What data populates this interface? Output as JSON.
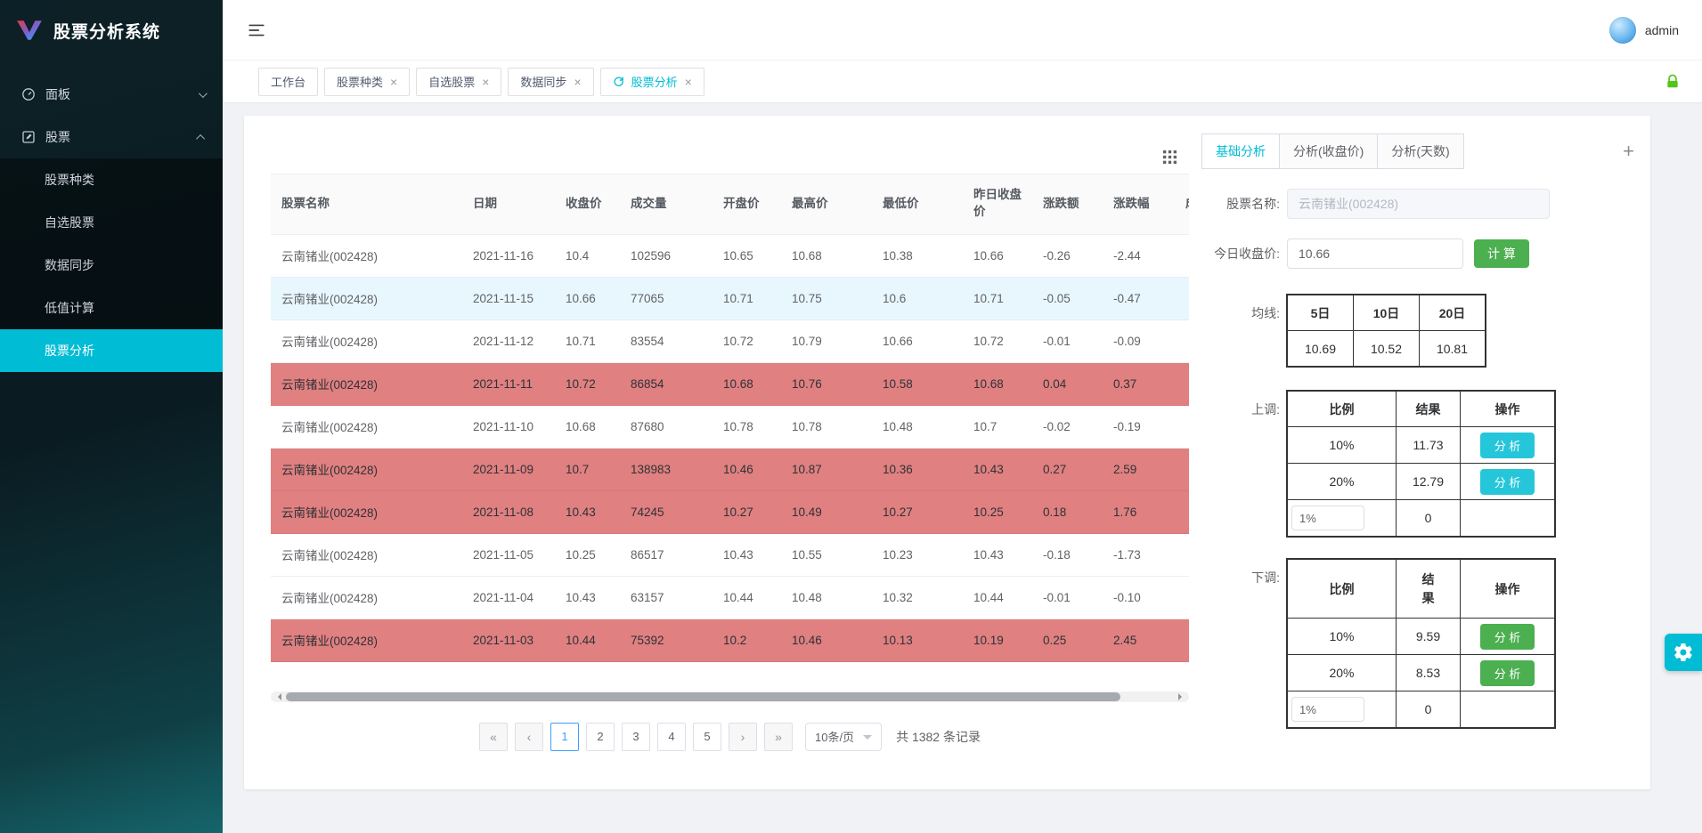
{
  "app": {
    "title": "股票分析系统"
  },
  "topbar": {
    "username": "admin"
  },
  "sidebar": {
    "items": [
      {
        "label": "面板",
        "icon": "dashboard-icon",
        "state": "collapsed"
      },
      {
        "label": "股票",
        "icon": "edit-square-icon",
        "state": "expanded"
      }
    ],
    "subitems": [
      {
        "label": "股票种类",
        "active": false
      },
      {
        "label": "自选股票",
        "active": false
      },
      {
        "label": "数据同步",
        "active": false
      },
      {
        "label": "低值计算",
        "active": false
      },
      {
        "label": "股票分析",
        "active": true
      }
    ]
  },
  "tabbar": {
    "tabs": [
      {
        "label": "工作台",
        "closable": false,
        "active": false
      },
      {
        "label": "股票种类",
        "closable": true,
        "active": false
      },
      {
        "label": "自选股票",
        "closable": true,
        "active": false
      },
      {
        "label": "数据同步",
        "closable": true,
        "active": false
      },
      {
        "label": "股票分析",
        "closable": true,
        "active": true
      }
    ]
  },
  "table": {
    "headers": [
      "股票名称",
      "日期",
      "收盘价",
      "成交量",
      "开盘价",
      "最高价",
      "最低价",
      "昨日收盘价",
      "涨跌额",
      "涨跌幅",
      "成交金额"
    ],
    "rows": [
      {
        "highlight": "none",
        "cells": [
          "云南锗业(002428)",
          "2021-11-16",
          "10.4",
          "102596",
          "10.65",
          "10.68",
          "10.38",
          "10.66",
          "-0.26",
          "-2.44",
          ""
        ]
      },
      {
        "highlight": "blue",
        "cells": [
          "云南锗业(002428)",
          "2021-11-15",
          "10.66",
          "77065",
          "10.71",
          "10.75",
          "10.6",
          "10.71",
          "-0.05",
          "-0.47",
          ""
        ]
      },
      {
        "highlight": "none",
        "cells": [
          "云南锗业(002428)",
          "2021-11-12",
          "10.71",
          "83554",
          "10.72",
          "10.79",
          "10.66",
          "10.72",
          "-0.01",
          "-0.09",
          ""
        ]
      },
      {
        "highlight": "red",
        "cells": [
          "云南锗业(002428)",
          "2021-11-11",
          "10.72",
          "86854",
          "10.68",
          "10.76",
          "10.58",
          "10.68",
          "0.04",
          "0.37",
          ""
        ]
      },
      {
        "highlight": "none",
        "cells": [
          "云南锗业(002428)",
          "2021-11-10",
          "10.68",
          "87680",
          "10.78",
          "10.78",
          "10.48",
          "10.7",
          "-0.02",
          "-0.19",
          ""
        ]
      },
      {
        "highlight": "red",
        "cells": [
          "云南锗业(002428)",
          "2021-11-09",
          "10.7",
          "138983",
          "10.46",
          "10.87",
          "10.36",
          "10.43",
          "0.27",
          "2.59",
          ""
        ]
      },
      {
        "highlight": "red",
        "cells": [
          "云南锗业(002428)",
          "2021-11-08",
          "10.43",
          "74245",
          "10.27",
          "10.49",
          "10.27",
          "10.25",
          "0.18",
          "1.76",
          ""
        ]
      },
      {
        "highlight": "none",
        "cells": [
          "云南锗业(002428)",
          "2021-11-05",
          "10.25",
          "86517",
          "10.43",
          "10.55",
          "10.23",
          "10.43",
          "-0.18",
          "-1.73",
          ""
        ]
      },
      {
        "highlight": "none",
        "cells": [
          "云南锗业(002428)",
          "2021-11-04",
          "10.43",
          "63157",
          "10.44",
          "10.48",
          "10.32",
          "10.44",
          "-0.01",
          "-0.10",
          ""
        ]
      },
      {
        "highlight": "red",
        "cells": [
          "云南锗业(002428)",
          "2021-11-03",
          "10.44",
          "75392",
          "10.2",
          "10.46",
          "10.13",
          "10.19",
          "0.25",
          "2.45",
          ""
        ]
      }
    ]
  },
  "pagination": {
    "pages": [
      "1",
      "2",
      "3",
      "4",
      "5"
    ],
    "active_page": "1",
    "page_size": "10条/页",
    "total_text": "共 1382 条记录"
  },
  "analysis": {
    "tabs": [
      {
        "label": "基础分析",
        "active": true
      },
      {
        "label": "分析(收盘价)",
        "active": false
      },
      {
        "label": "分析(天数)",
        "active": false
      }
    ],
    "stock_name": {
      "label": "股票名称:",
      "value": "云南锗业(002428)"
    },
    "today_close": {
      "label": "今日收盘价:",
      "value": "10.66",
      "button": "计 算"
    },
    "ma": {
      "label": "均线:",
      "headers": [
        "5日",
        "10日",
        "20日"
      ],
      "values": [
        "10.69",
        "10.52",
        "10.81"
      ]
    },
    "up": {
      "label": "上调:",
      "headers": [
        "比例",
        "结果",
        "操作"
      ],
      "rows": [
        {
          "ratio": "10%",
          "result": "11.73",
          "action": "分 析"
        },
        {
          "ratio": "20%",
          "result": "12.79",
          "action": "分 析"
        }
      ],
      "custom": {
        "input_value": "1%",
        "result": "0"
      }
    },
    "down": {
      "label": "下调:",
      "headers": [
        "比例",
        "结果",
        "操作"
      ],
      "rows": [
        {
          "ratio": "10%",
          "result": "9.59",
          "action": "分 析"
        },
        {
          "ratio": "20%",
          "result": "8.53",
          "action": "分 析"
        }
      ],
      "custom": {
        "input_value": "1%",
        "result": "0"
      }
    }
  },
  "icons": {
    "close_glyph": "×",
    "plus_glyph": "+",
    "first_page_glyph": "«",
    "prev_page_glyph": "‹",
    "next_page_glyph": "›",
    "last_page_glyph": "»"
  },
  "colors": {
    "accent": "#00bcd4",
    "green": "#4caf50",
    "up_button": "#26c6da",
    "red_row": "#e08080",
    "blue_row": "#e8f7fe",
    "active_page": "#409eff"
  }
}
